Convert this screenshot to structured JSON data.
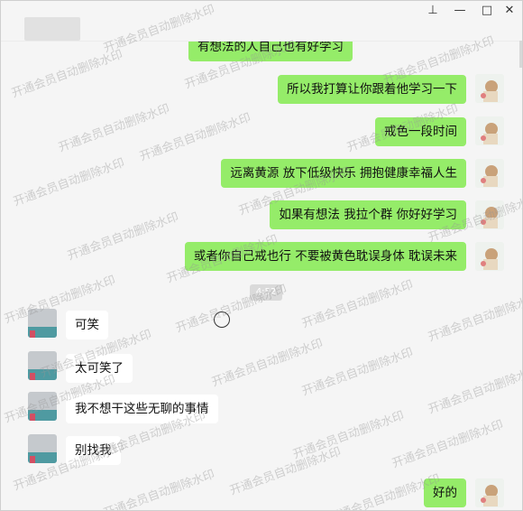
{
  "window": {
    "pin_icon": "pin-icon",
    "minimize_icon": "minimize-icon",
    "maximize_icon": "maximize-icon",
    "close_icon": "close-icon",
    "pin_glyph": "⊥",
    "minimize_glyph": "—",
    "maximize_glyph": "□",
    "close_glyph": "✕"
  },
  "chat": {
    "partial_top": "有想法的人自己也有好学习",
    "outgoing": [
      "所以我打算让你跟着他学习一下",
      "戒色一段时间",
      "远离黄源  放下低级快乐  拥抱健康幸福人生",
      "如果有想法 我拉个群  你好好学习",
      "或者你自己戒也行   不要被黄色耽误身体  耽误未来"
    ],
    "timestamp": "4:52",
    "incoming": [
      "可笑",
      "太可笑了",
      "我不想干这些无聊的事情",
      "别找我"
    ],
    "last_outgoing": "好的"
  },
  "watermark": "开通会员自动删除水印",
  "colors": {
    "my_bubble": "#95ec69",
    "their_bubble": "#ffffff",
    "background": "#f5f5f5"
  }
}
